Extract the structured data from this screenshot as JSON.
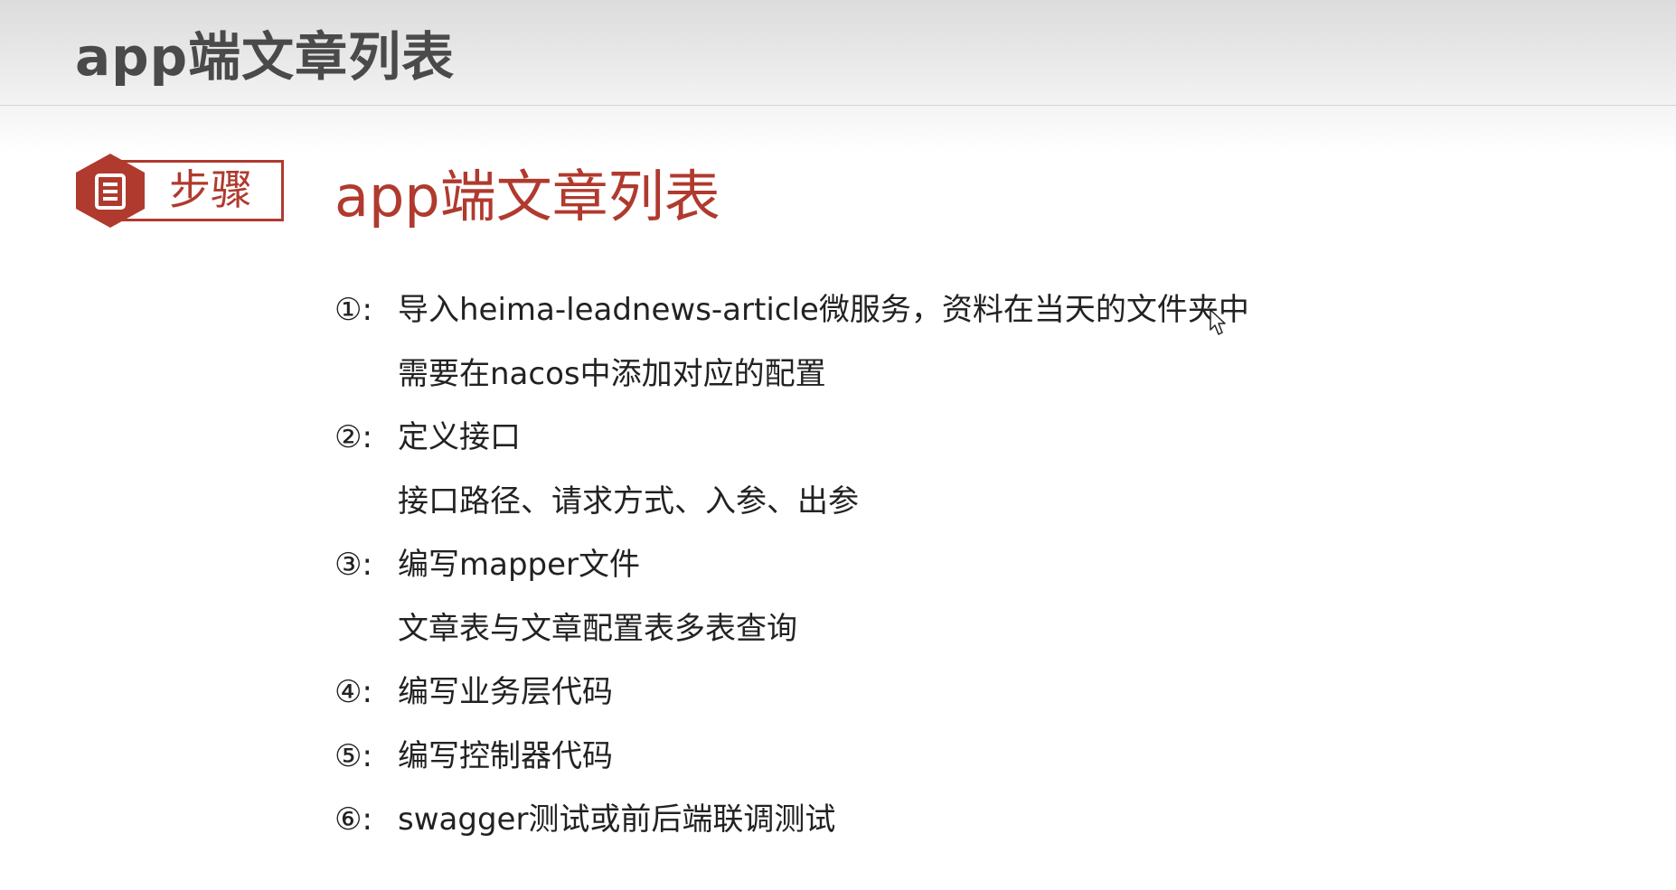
{
  "header": {
    "title": "app端文章列表"
  },
  "badge": {
    "label": "步骤",
    "icon": "document-icon",
    "accent_color": "#b03a2e"
  },
  "section": {
    "title": "app端文章列表"
  },
  "steps": [
    {
      "number": "①:",
      "text": "导入heima-leadnews-article微服务，资料在当天的文件夹中"
    },
    {
      "number": "",
      "text": "需要在nacos中添加对应的配置"
    },
    {
      "number": "②:",
      "text": "定义接口"
    },
    {
      "number": "",
      "text": "接口路径、请求方式、入参、出参"
    },
    {
      "number": "③:",
      "text": "编写mapper文件"
    },
    {
      "number": "",
      "text": "文章表与文章配置表多表查询"
    },
    {
      "number": "④:",
      "text": "编写业务层代码"
    },
    {
      "number": "⑤:",
      "text": "编写控制器代码"
    },
    {
      "number": "⑥:",
      "text": "swagger测试或前后端联调测试"
    }
  ],
  "colors": {
    "title_gray": "#4a4a4a",
    "accent_red": "#b03a2e",
    "body_text": "#222222"
  }
}
